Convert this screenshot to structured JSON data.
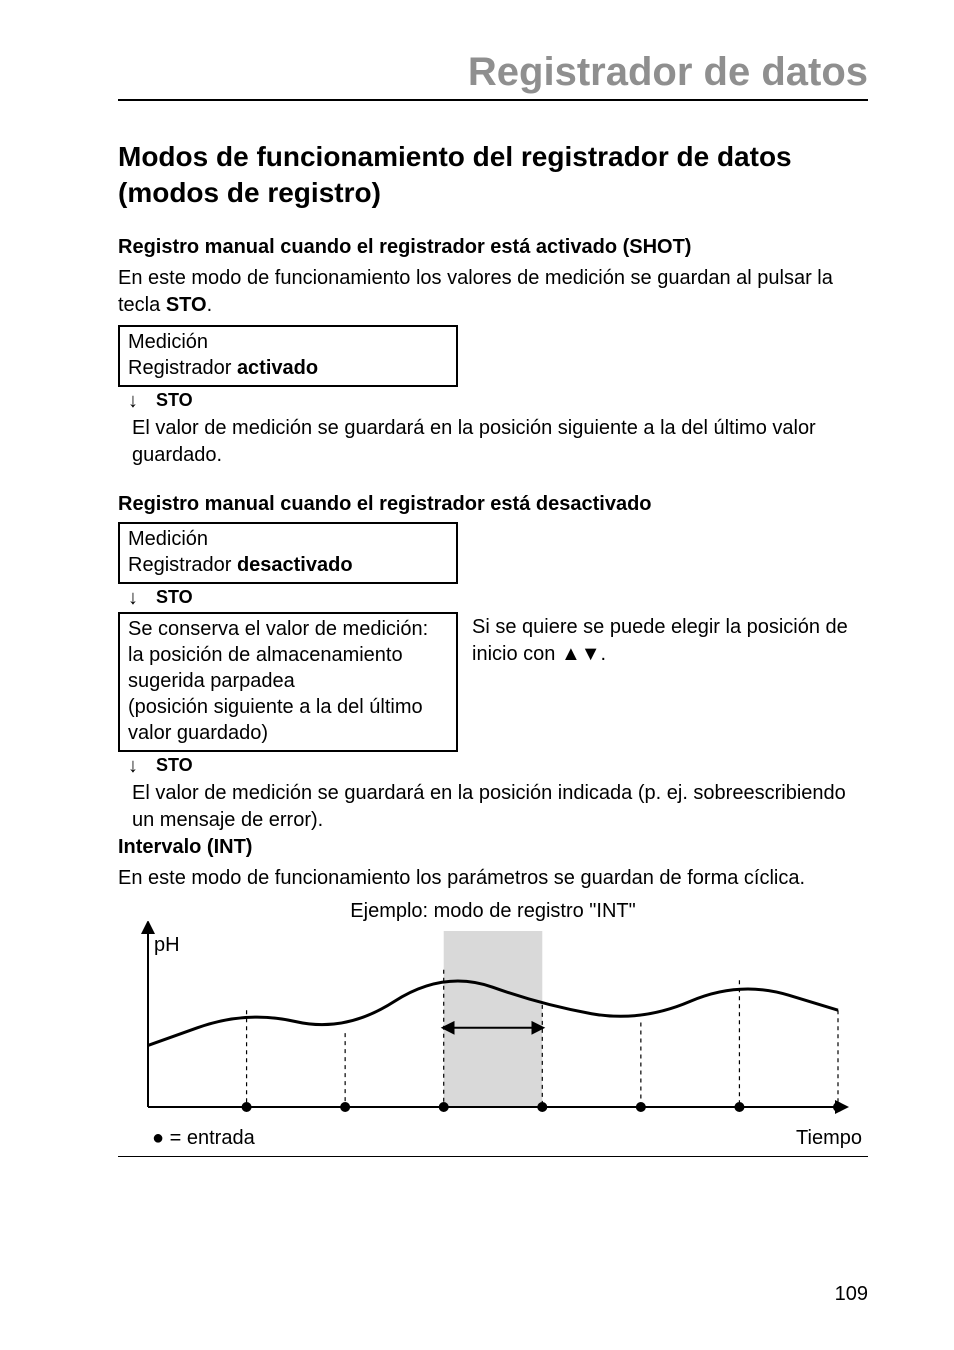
{
  "header": {
    "title": "Registrador de datos"
  },
  "h1": "Modos de funcionamiento del registrador de datos (modos de registro)",
  "section_shot": {
    "heading": "Registro manual cuando el registrador está activado (SHOT)",
    "intro_a": "En este modo de funcionamiento los valores de medición se guardan al pulsar la tecla ",
    "intro_key": "STO",
    "intro_b": ".",
    "box1_line1": "Medición",
    "box1_line2a": "Registrador ",
    "box1_line2b": "activado",
    "sto": "STO",
    "result": "El valor de medición se guardará en la posición siguiente a la del último valor guardado."
  },
  "section_off": {
    "heading": "Registro manual cuando el registrador está desactivado",
    "box1_line1": "Medición",
    "box1_line2a": "Registrador ",
    "box1_line2b": "desactivado",
    "sto": "STO",
    "box2_l1": "Se conserva el valor de medición:",
    "box2_l2": "la posición de almacenamiento sugerida parpadea",
    "box2_l3": "(posición siguiente a la del último valor guardado)",
    "right_a": "Si se quiere se puede elegir la posición de inicio con ",
    "right_arrows": "▲▼",
    "right_b": ".",
    "result": "El valor de medición se guardará en la posición indicada (p. ej. sobreescribiendo un mensaje de error)."
  },
  "section_int": {
    "heading": "Intervalo (INT)",
    "intro": "En este modo de funcionamiento los parámetros se guardan de forma cíclica.",
    "caption": "Ejemplo: modo de registro \"INT\"",
    "y_label": "pH",
    "x_label": "Tiempo",
    "legend": "= entrada"
  },
  "page_number": "109",
  "chart_data": {
    "type": "line",
    "title": "Ejemplo: modo de registro \"INT\"",
    "xlabel": "Tiempo",
    "ylabel": "pH",
    "x": [
      0,
      1,
      2,
      3,
      4,
      5,
      6,
      7
    ],
    "values": [
      35,
      55,
      42,
      78,
      58,
      48,
      72,
      55
    ],
    "sample_points_x": [
      1,
      2,
      3,
      4,
      5,
      6,
      7
    ],
    "interval_highlight": [
      3,
      4
    ],
    "ylim": [
      0,
      100
    ]
  }
}
